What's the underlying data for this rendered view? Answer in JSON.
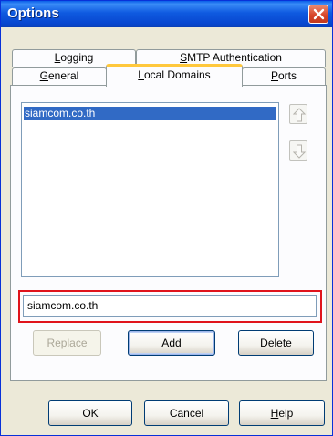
{
  "window": {
    "title": "Options"
  },
  "tabs": {
    "row_back": [
      {
        "label": "Logging",
        "accel": "L",
        "rest": "ogging"
      },
      {
        "label": "SMTP Authentication",
        "accel": "S",
        "rest": "MTP Authentication"
      }
    ],
    "row_front": [
      {
        "label": "General",
        "accel": "G",
        "rest": "eneral"
      },
      {
        "label": "Local Domains",
        "accel": "L",
        "rest": "ocal Domains",
        "active": true
      },
      {
        "label": "Ports",
        "accel": "P",
        "rest": "orts"
      }
    ]
  },
  "domains": {
    "items": [
      "siamcom.co.th"
    ],
    "selected_index": 0
  },
  "domain_input": {
    "value": "siamcom.co.th",
    "placeholder": ""
  },
  "buttons": {
    "replace": {
      "label": "Replace",
      "pre": "Repla",
      "accel": "c",
      "post": "e",
      "enabled": false
    },
    "add": {
      "label": "Add",
      "pre": "A",
      "accel": "d",
      "post": "d",
      "enabled": true
    },
    "delete": {
      "label": "Delete",
      "pre": "D",
      "accel": "e",
      "post": "lete",
      "enabled": true
    },
    "ok": {
      "label": "OK"
    },
    "cancel": {
      "label": "Cancel"
    },
    "help": {
      "label": "Help",
      "accel": "H",
      "rest": "elp"
    }
  },
  "icons": {
    "move_up": "arrow-up-icon",
    "move_down": "arrow-down-icon",
    "close": "close-icon"
  },
  "colors": {
    "titlebar": "#0a5ee8",
    "selection": "#316ac5",
    "highlight_border": "#e0141c",
    "active_tab_accent": "#ffc83c"
  }
}
